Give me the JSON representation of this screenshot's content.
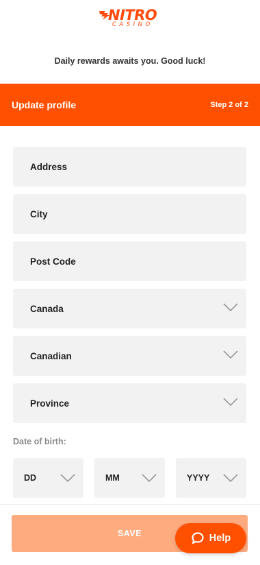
{
  "brand": {
    "logo_text": "NITRO",
    "logo_sub": "CASINO",
    "accent": "#ff5000",
    "accent_light": "#ffab80"
  },
  "tagline": "Daily rewards awaits you. Good luck!",
  "header": {
    "title": "Update profile",
    "step": "Step 2 of 2"
  },
  "form": {
    "address_placeholder": "Address",
    "city_placeholder": "City",
    "postcode_placeholder": "Post Code",
    "country_value": "Canada",
    "nationality_value": "Canadian",
    "province_placeholder": "Province",
    "dob_label": "Date of birth:",
    "dob_day": "DD",
    "dob_month": "MM",
    "dob_year": "YYYY"
  },
  "actions": {
    "save_label": "SAVE",
    "help_label": "Help"
  },
  "icons": {
    "dropdown": "chevron-down-icon",
    "help": "chat-bubble-icon",
    "logo": "flame-icon"
  }
}
